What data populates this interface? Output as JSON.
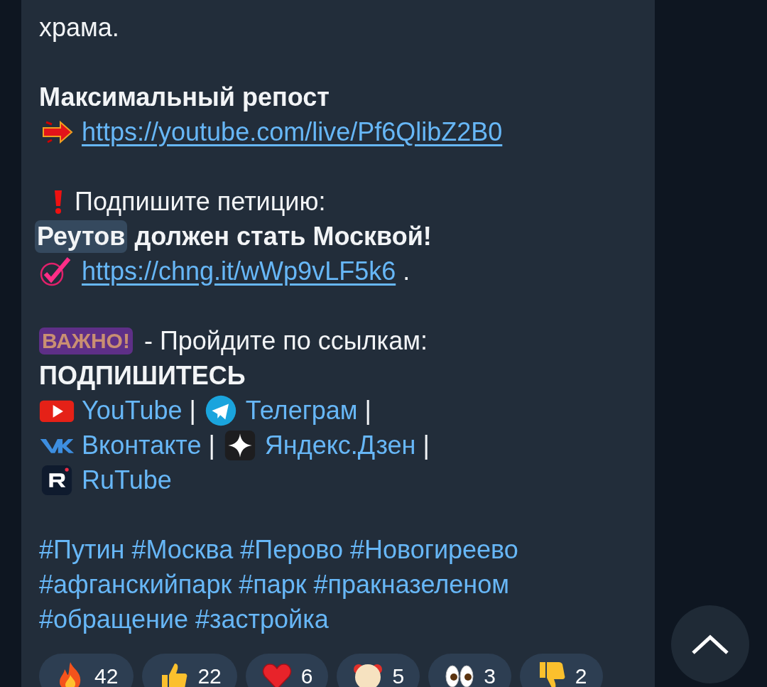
{
  "message": {
    "blocks": [
      [
        [
          {
            "kind": "text",
            "text": "храма."
          }
        ]
      ],
      [
        [
          {
            "kind": "bold",
            "text": "Максимальный репост"
          }
        ],
        [
          {
            "kind": "arrow"
          },
          {
            "kind": "url",
            "text": "https://youtube.com/live/Pf6QlibZ2B0"
          }
        ]
      ],
      [
        [
          {
            "kind": "exclamation"
          },
          {
            "kind": "text",
            "text": "Подпишите петицию:"
          }
        ],
        [
          {
            "kind": "bold",
            "text": "Реутов",
            "highlighted": true
          },
          {
            "kind": "bold",
            "text": "должен стать Москвой!",
            "highlighted": false
          }
        ],
        [
          {
            "kind": "check"
          },
          {
            "kind": "url",
            "text": "https://chng.it/wWp9vLF5k6"
          },
          {
            "kind": "text",
            "text": "."
          }
        ]
      ],
      [
        [
          {
            "kind": "badge",
            "text": "ВАЖНО!"
          },
          {
            "kind": "text",
            "text": "- Пройдите по ссылкам:"
          }
        ],
        [
          {
            "kind": "bold",
            "text": "ПОДПИШИТЕСЬ"
          }
        ],
        [
          {
            "kind": "play"
          },
          {
            "kind": "link",
            "text": "YouTube"
          },
          {
            "kind": "text",
            "text": "|"
          },
          {
            "kind": "plane"
          },
          {
            "kind": "link",
            "text": "Телеграм"
          },
          {
            "kind": "text",
            "text": "|"
          }
        ],
        [
          {
            "kind": "chevrons"
          },
          {
            "kind": "link",
            "text": "Вконтакте"
          },
          {
            "kind": "text",
            "text": "|"
          },
          {
            "kind": "sparkle"
          },
          {
            "kind": "link",
            "text": "Яндекс.Дзен"
          },
          {
            "kind": "text",
            "text": "|"
          }
        ],
        [
          {
            "kind": "applogo"
          },
          {
            "kind": "link",
            "text": "RuTube"
          }
        ]
      ],
      [
        [
          {
            "kind": "hashtag",
            "text": "#Путин"
          },
          {
            "kind": "hashtag",
            "text": "#Москва"
          },
          {
            "kind": "hashtag",
            "text": "#Перово"
          },
          {
            "kind": "hashtag",
            "text": "#Новогиреево"
          }
        ],
        [
          {
            "kind": "hashtag",
            "text": "#афганскийпарк"
          },
          {
            "kind": "hashtag",
            "text": "#парк"
          },
          {
            "kind": "hashtag",
            "text": "#пракназеленом"
          }
        ],
        [
          {
            "kind": "hashtag",
            "text": "#обращение"
          },
          {
            "kind": "hashtag",
            "text": "#застройка"
          }
        ]
      ]
    ]
  },
  "reactions": [
    {
      "kind": "fire",
      "count": "42"
    },
    {
      "kind": "thumbsup",
      "count": "22"
    },
    {
      "kind": "heart",
      "count": "6"
    },
    {
      "kind": "clown",
      "count": "5"
    },
    {
      "kind": "eyes",
      "count": "3"
    },
    {
      "kind": "thumbsdown",
      "count": "2"
    }
  ]
}
